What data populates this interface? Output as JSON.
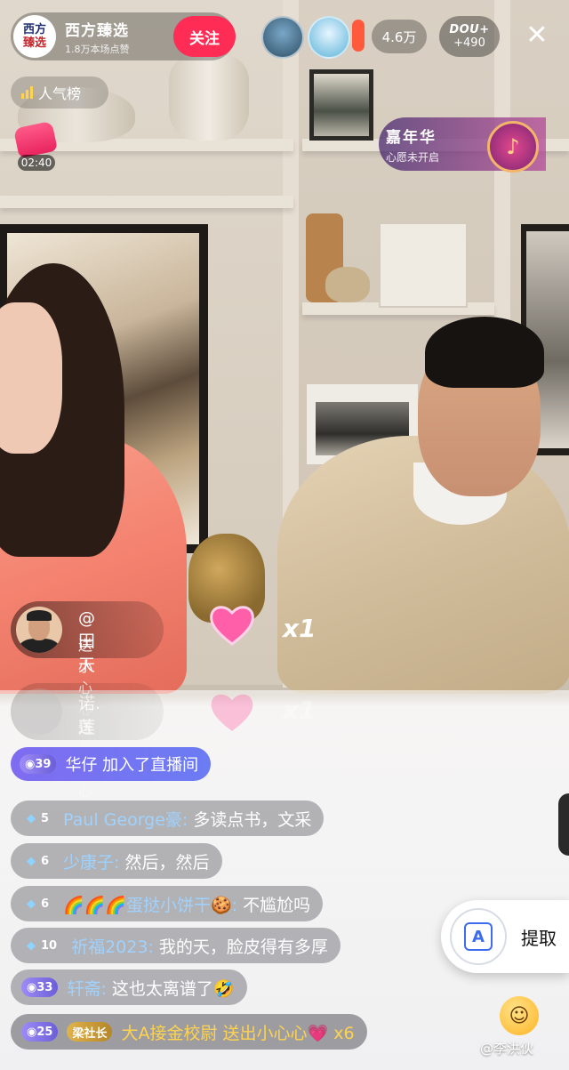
{
  "host": {
    "avatar_line1": "西方",
    "avatar_line2": "臻选",
    "name": "西方臻选",
    "subtitle": "1.8万本场点赞",
    "follow_label": "关注"
  },
  "viewers": {
    "count": "4.6万"
  },
  "rank": {
    "logo": "DOU+",
    "value": "+490"
  },
  "popularity": {
    "label": "人气榜"
  },
  "timer": {
    "time": "02:40"
  },
  "carnival": {
    "title": "嘉年华",
    "subtitle": "心愿未开启"
  },
  "gifts": [
    {
      "user": "@田天",
      "action": "送小心心",
      "count": "x1"
    },
    {
      "user": "诺.莲",
      "action": "送小心心",
      "count": "x1"
    }
  ],
  "join": {
    "level": "39",
    "user": "华仔",
    "text": "加入了直播间"
  },
  "chat": [
    {
      "level": "5",
      "user": "Paul George豪:",
      "msg": "多读点书，文采"
    },
    {
      "level": "6",
      "user": "少康子:",
      "msg": "然后，然后"
    },
    {
      "level": "6",
      "user": "🌈🌈🌈蛋挞小饼干🍪:",
      "msg": "不尴尬吗"
    },
    {
      "level": "10",
      "user": "祈福2023:",
      "msg": "我的天，脸皮得有多厚"
    },
    {
      "level": "33",
      "user": "轩斋:",
      "msg": "这也太离谱了🤣"
    },
    {
      "level": "25",
      "user": "大A接金校尉",
      "msg": "送出小心心💗 x6",
      "tag": "梁社长"
    }
  ],
  "ocr": {
    "label": "提取"
  },
  "watermark": "@李洪伙",
  "colors": {
    "follow": "#ff2c55",
    "join_bg": "#7f6cf0",
    "chat_user": "#9fd2ff",
    "ocr_accent": "#3d6cf0"
  },
  "icons": [
    "close-icon",
    "signal-bars-icon",
    "gift-bag-icon",
    "carnival-icon",
    "heart-icon",
    "diamond-icon",
    "text-extract-icon",
    "emoji-icon"
  ]
}
